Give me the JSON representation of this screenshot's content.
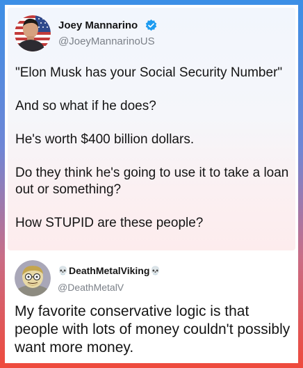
{
  "post1": {
    "author_name": "Joey Mannarino",
    "author_handle": "@JoeyMannarinoUS",
    "verified": true,
    "avatar_icon": "profile-photo-flag-background",
    "body_paragraphs": [
      "\"Elon Musk has your Social Security Number\"",
      "And so what if he does?",
      "He's worth $400 billion dollars.",
      "Do they think he's going to use it to take a loan out or something?",
      "How STUPID are these people?"
    ]
  },
  "post2": {
    "author_name": "DeathMetalViking",
    "name_prefix_emoji": "💀",
    "name_suffix_emoji": "💀",
    "author_handle": "@DeathMetalV",
    "avatar_icon": "cartoon-avatar",
    "body": "My favorite conservative logic is that people with lots of money couldn't possibly want more money."
  },
  "colors": {
    "border_top": "#3c8fe6",
    "border_bottom": "#ef4a3c",
    "verified_badge": "#1d9bf0",
    "handle_text": "#7b8088",
    "body_text": "#141414"
  }
}
